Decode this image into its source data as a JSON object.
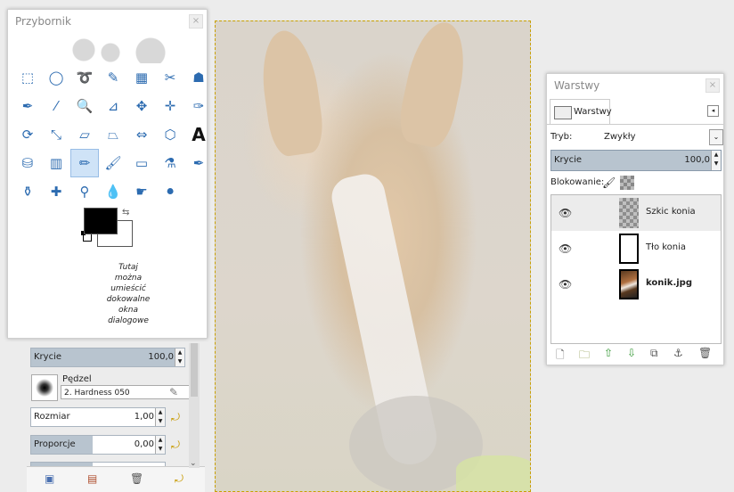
{
  "toolbox": {
    "title": "Przybornik",
    "close": "×",
    "dock_hint": "Tutaj\nmożna\numieścić\ndokowalne\nokna\ndialogowe",
    "tools": [
      {
        "name": "rect-select-icon",
        "glyph": "⬚"
      },
      {
        "name": "ellipse-select-icon",
        "glyph": "◯"
      },
      {
        "name": "free-select-icon",
        "glyph": "➰"
      },
      {
        "name": "fuzzy-select-icon",
        "glyph": "✎"
      },
      {
        "name": "select-by-color-icon",
        "glyph": "▦"
      },
      {
        "name": "scissors-icon",
        "glyph": "✂"
      },
      {
        "name": "foreground-select-icon",
        "glyph": "☗"
      },
      {
        "name": "paths-icon",
        "glyph": "✒"
      },
      {
        "name": "color-picker-icon",
        "glyph": "⁄"
      },
      {
        "name": "zoom-icon",
        "glyph": "🔍"
      },
      {
        "name": "measure-icon",
        "glyph": "⊿"
      },
      {
        "name": "move-icon",
        "glyph": "✥"
      },
      {
        "name": "align-icon",
        "glyph": "✛"
      },
      {
        "name": "crop-icon",
        "glyph": "✑"
      },
      {
        "name": "rotate-icon",
        "glyph": "⟳"
      },
      {
        "name": "scale-icon",
        "glyph": "⤡"
      },
      {
        "name": "shear-icon",
        "glyph": "▱"
      },
      {
        "name": "perspective-icon",
        "glyph": "⏢"
      },
      {
        "name": "flip-icon",
        "glyph": "⇔"
      },
      {
        "name": "cage-icon",
        "glyph": "⬡"
      },
      {
        "name": "text-icon",
        "glyph": "A"
      },
      {
        "name": "bucket-fill-icon",
        "glyph": "⛁"
      },
      {
        "name": "gradient-icon",
        "glyph": "▥"
      },
      {
        "name": "pencil-icon",
        "glyph": "✏"
      },
      {
        "name": "paintbrush-icon",
        "glyph": "🖌"
      },
      {
        "name": "eraser-icon",
        "glyph": "▭"
      },
      {
        "name": "airbrush-icon",
        "glyph": "⚗"
      },
      {
        "name": "ink-icon",
        "glyph": "✒"
      },
      {
        "name": "clone-icon",
        "glyph": "⚱"
      },
      {
        "name": "heal-icon",
        "glyph": "✚"
      },
      {
        "name": "perspective-clone-icon",
        "glyph": "⚲"
      },
      {
        "name": "blur-icon",
        "glyph": "💧"
      },
      {
        "name": "smudge-icon",
        "glyph": "☛"
      },
      {
        "name": "dodge-burn-icon",
        "glyph": "⚫"
      }
    ],
    "active_tool_index": 23
  },
  "tool_options": {
    "opacity_label": "Krycie",
    "opacity_value": "100,0",
    "brush_label": "Pędzel",
    "brush_name": "2. Hardness 050",
    "size_label": "Rozmiar",
    "size_value": "1,00",
    "ratio_label": "Proporcje",
    "ratio_value": "0,00"
  },
  "layers": {
    "title": "Warstwy",
    "close": "×",
    "tab_label": "Warstwy",
    "mode_label": "Tryb:",
    "mode_value": "Zwykły",
    "opacity_label": "Krycie",
    "opacity_value": "100,0",
    "lock_label": "Blokowanie:",
    "items": [
      {
        "name": "Szkic konia",
        "bold": false,
        "thumb": "checker",
        "selected": true
      },
      {
        "name": "Tło konia",
        "bold": false,
        "thumb": "white",
        "selected": false
      },
      {
        "name": "konik.jpg",
        "bold": true,
        "thumb": "photo",
        "selected": false
      }
    ]
  },
  "colors": {
    "foreground": "#000000",
    "background": "#ffffff",
    "selection": "#b8c4cf"
  }
}
